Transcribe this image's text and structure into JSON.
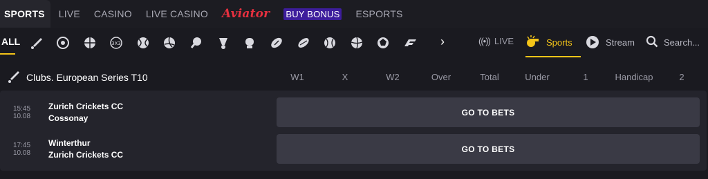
{
  "topnav": {
    "items": [
      {
        "label": "SPORTS"
      },
      {
        "label": "LIVE"
      },
      {
        "label": "CASINO"
      },
      {
        "label": "LIVE CASINO"
      },
      {
        "label": "Aviator"
      },
      {
        "label": "BUY BONUS"
      },
      {
        "label": "ESPORTS"
      }
    ]
  },
  "sportbar": {
    "all_label": "ALL",
    "icons": [
      "cricket-icon",
      "football-icon",
      "basketball-icon",
      "basketball-3x3-icon",
      "tennis-icon",
      "volleyball-icon",
      "table-tennis-icon",
      "badminton-icon",
      "boxing-icon",
      "american-football-icon",
      "rugby-icon",
      "baseball-icon",
      "beach-volleyball-icon",
      "futsal-icon",
      "formula1-icon"
    ],
    "chevron": "›",
    "live_label": "LIVE",
    "sports_label": "Sports",
    "stream_label": "Stream",
    "search_label": "Search..."
  },
  "league": {
    "title": "Clubs. European Series T10",
    "columns": [
      "W1",
      "X",
      "W2",
      "Over",
      "Total",
      "Under",
      "1",
      "Handicap",
      "2"
    ]
  },
  "matches": [
    {
      "time": "15:45",
      "date": "10.08",
      "team1": "Zurich Crickets CC",
      "team2": "Cossonay",
      "button": "GO TO BETS"
    },
    {
      "time": "17:45",
      "date": "10.08",
      "team1": "Winterthur",
      "team2": "Zurich Crickets CC",
      "button": "GO TO BETS"
    }
  ],
  "colors": {
    "accent": "#f5c518",
    "aviator": "#e6303f",
    "buy_bonus_bg": "#3d1d9c",
    "panel": "#24242c",
    "button": "#3a3a45"
  }
}
